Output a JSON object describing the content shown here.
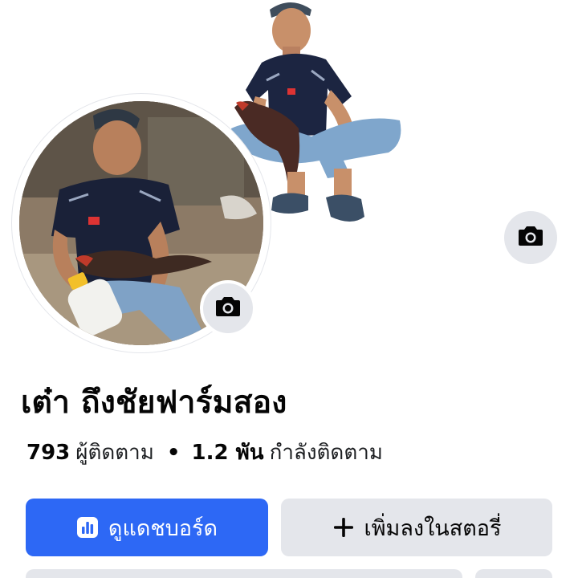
{
  "profile": {
    "name": "เต๋า ถึงชัยฟาร์มสอง",
    "followers_count": "793",
    "followers_label": "ผู้ติดตาม",
    "separator": "•",
    "following_count": "1.2 พัน",
    "following_label": "กำลังติดตาม"
  },
  "actions": {
    "dashboard_label": "ดูแดชบอร์ด",
    "add_story_label": "เพิ่มลงในสตอรี่"
  },
  "icons": {
    "cover_camera": "camera-icon",
    "avatar_camera": "camera-icon",
    "dashboard": "bar-chart-icon",
    "add_story": "plus-icon"
  },
  "colors": {
    "primary_button": "#2d68f5",
    "secondary_button": "#e4e6eb",
    "text": "#050505"
  }
}
